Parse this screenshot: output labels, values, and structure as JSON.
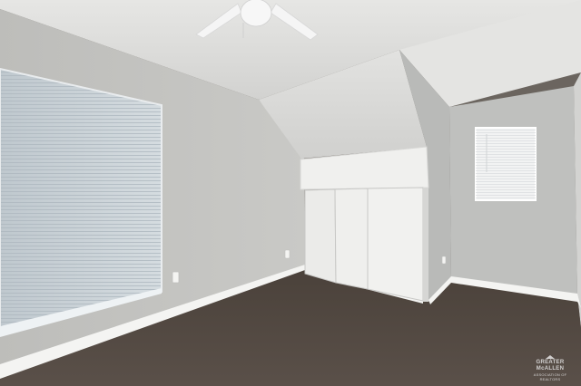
{
  "scene": {
    "subject": "empty-bedroom",
    "colors": {
      "wall": "#c4c4c1",
      "wall_shadow": "#a9aaa8",
      "ceiling": "#dcdcda",
      "carpet": "#4f453e",
      "trim": "#f4f4f2",
      "blind": "#c9d1d6",
      "closet": "#f0f0ee",
      "fan": "#f5f5f5"
    },
    "icons": [
      "ceiling-fan-icon",
      "window-blind-icon",
      "outlet-icon"
    ]
  },
  "watermark": {
    "line1": "GREATER McALLEN",
    "line2": "ASSOCIATION OF REALTORS"
  }
}
